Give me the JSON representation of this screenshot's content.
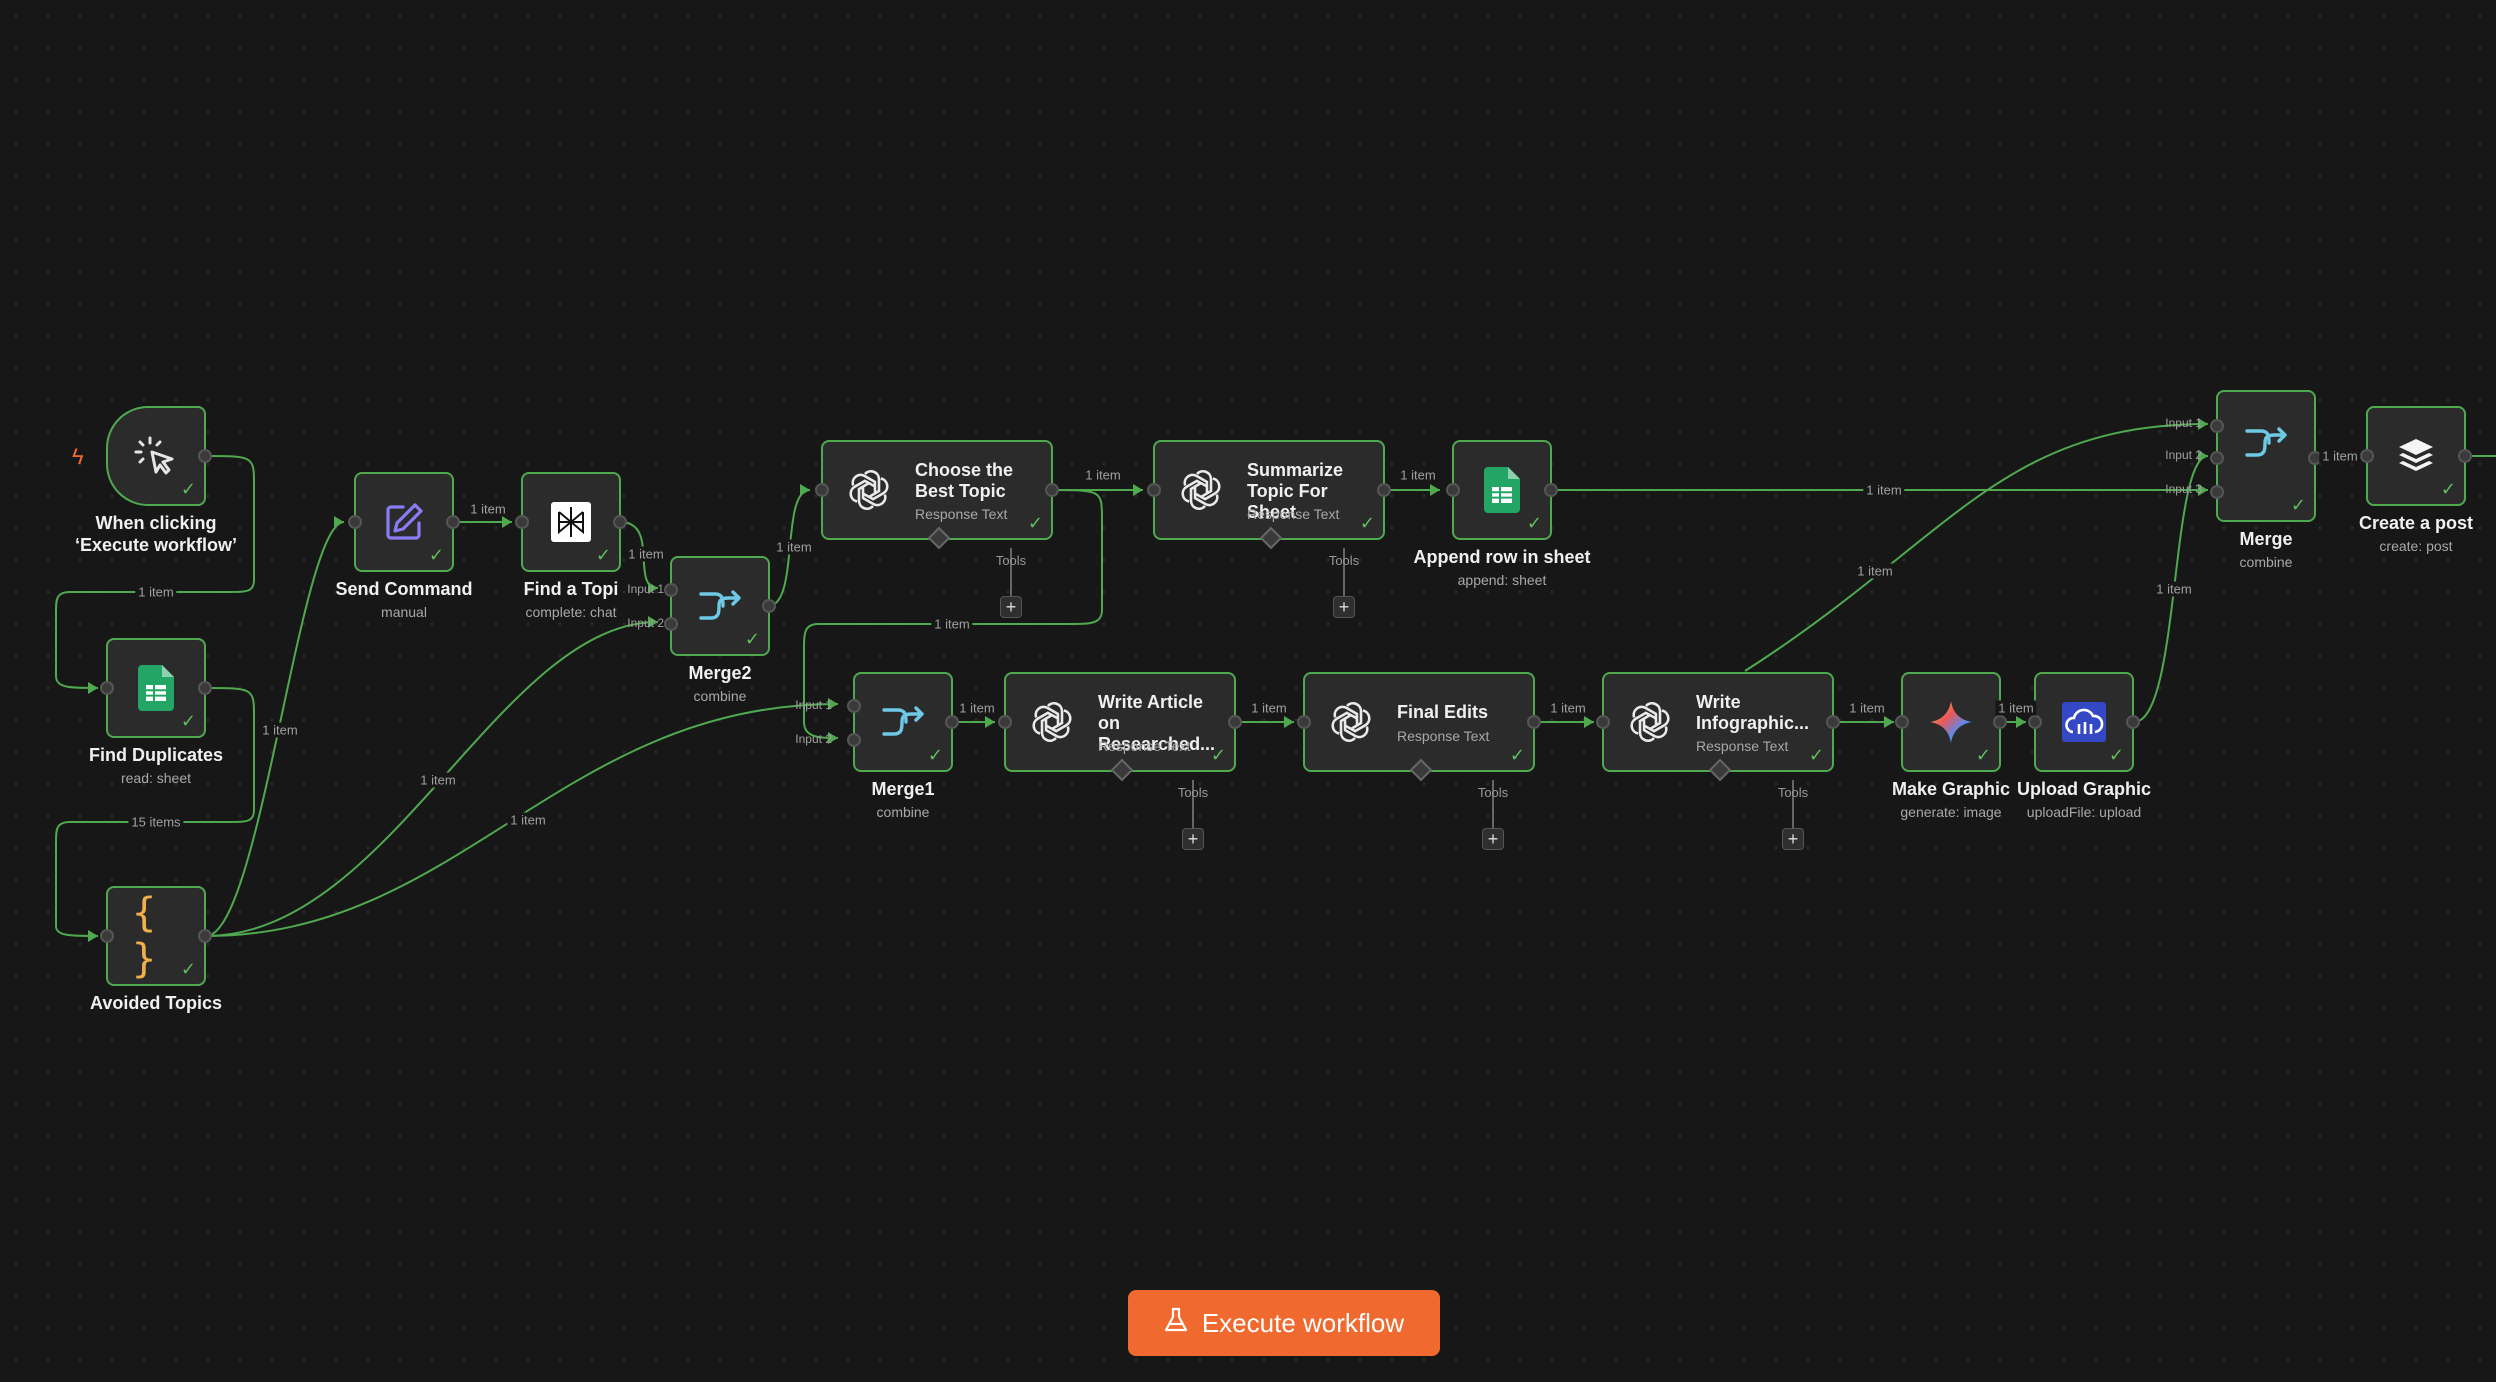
{
  "nodes": {
    "trigger": {
      "title": "When clicking ‘Execute workflow’",
      "icon": "cursor-click-icon"
    },
    "find_duplicates": {
      "title": "Find Duplicates",
      "subtitle": "read: sheet",
      "icon": "google-sheets-icon"
    },
    "avoided_topics": {
      "title": "Avoided Topics",
      "icon": "curly-braces-icon"
    },
    "send_command": {
      "title": "Send Command",
      "subtitle": "manual",
      "icon": "edit-icon"
    },
    "find_topic": {
      "title": "Find a Topi",
      "subtitle": "complete: chat",
      "icon": "perplexity-icon"
    },
    "merge2": {
      "title": "Merge2",
      "subtitle": "combine",
      "icon": "merge-icon"
    },
    "choose_topic": {
      "title": "Choose the Best Topic",
      "subtitle": "Response Text",
      "icon": "openai-icon"
    },
    "summarize": {
      "title": "Summarize Topic For Sheet",
      "subtitle": "Response Text",
      "icon": "openai-icon"
    },
    "append_row": {
      "title": "Append row in sheet",
      "subtitle": "append: sheet",
      "icon": "google-sheets-icon"
    },
    "merge1": {
      "title": "Merge1",
      "subtitle": "combine",
      "icon": "merge-icon"
    },
    "write_article": {
      "title": "Write Article on Researched...",
      "subtitle": "Response Text",
      "icon": "openai-icon"
    },
    "final_edits": {
      "title": "Final Edits",
      "subtitle": "Response Text",
      "icon": "openai-icon"
    },
    "write_infographic": {
      "title": "Write Infographic...",
      "subtitle": "Response Text",
      "icon": "openai-icon"
    },
    "make_graphic": {
      "title": "Make Graphic",
      "subtitle": "generate: image",
      "icon": "gemini-sparkle-icon"
    },
    "upload_graphic": {
      "title": "Upload Graphic",
      "subtitle": "uploadFile: upload",
      "icon": "cloudinary-icon"
    },
    "merge": {
      "title": "Merge",
      "subtitle": "combine",
      "icon": "merge-icon"
    },
    "create_post": {
      "title": "Create a post",
      "subtitle": "create: post",
      "icon": "buffer-icon"
    }
  },
  "edge_labels": {
    "one_item": "1 item",
    "fifteen_items": "15 items"
  },
  "port_labels": {
    "input1": "Input 1",
    "input2": "Input 2",
    "input3": "Input 3"
  },
  "tools_label": "Tools",
  "plus_label": "+",
  "execute_button": {
    "label": "Execute workflow",
    "icon": "flask-icon"
  },
  "colors": {
    "background": "#171717",
    "node_fill": "#2b2b2b",
    "success_green": "#4fa94f",
    "accent_orange": "#f0692e"
  }
}
